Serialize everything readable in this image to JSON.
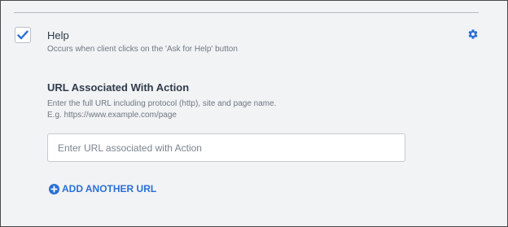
{
  "event": {
    "checked": true,
    "title": "Help",
    "description": "Occurs when client clicks on the 'Ask for Help' button"
  },
  "url_section": {
    "title": "URL Associated With Action",
    "help_line1": "Enter the full URL including protocol (http), site and page name.",
    "help_line2": "E.g. https://www.example.com/page",
    "input_placeholder": "Enter URL associated with Action",
    "input_value": ""
  },
  "add_url": {
    "label": "ADD ANOTHER URL"
  },
  "icons": {
    "checkbox": "checkmark-icon",
    "settings": "gear-icon",
    "add": "plus-circle-icon"
  },
  "colors": {
    "accent": "#2a6fd6",
    "background": "#f2f3f5",
    "text_primary": "#2e3b4a",
    "text_secondary": "#6e7781"
  }
}
